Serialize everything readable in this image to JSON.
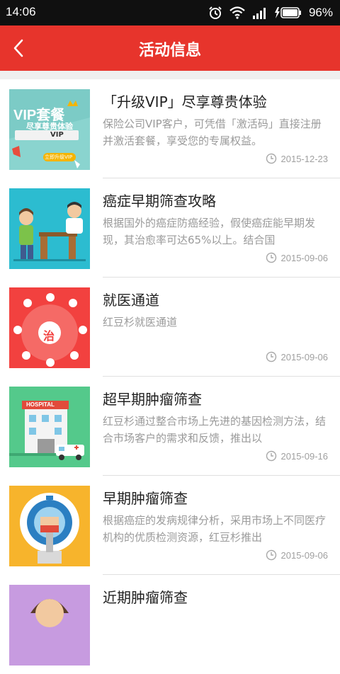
{
  "status": {
    "time": "14:06",
    "battery": "96%"
  },
  "header": {
    "title": "活动信息"
  },
  "items": [
    {
      "title": "「升级VIP」尽享尊贵体验",
      "desc": "保险公司VIP客户，可凭借「激活码」直接注册并激活套餐，享受您的专属权益。",
      "date": "2015-12-23",
      "thumb": {
        "line1": "VIP套餐",
        "line2": "尽享尊贵体验",
        "badge": "VIP",
        "button": "立即升级VIP"
      }
    },
    {
      "title": "癌症早期筛查攻略",
      "desc": "根据国外的癌症防癌经验，假使癌症能早期发现，其治愈率可达65%以上。结合国",
      "date": "2015-09-06"
    },
    {
      "title": "就医通道",
      "desc": "红豆杉就医通道",
      "date": "2015-09-06",
      "thumb": {
        "center": "治"
      }
    },
    {
      "title": "超早期肿瘤筛查",
      "desc": "红豆杉通过整合市场上先进的基因检测方法，结合市场客户的需求和反馈，推出以",
      "date": "2015-09-16",
      "thumb": {
        "sign": "HOSPITAL"
      }
    },
    {
      "title": "早期肿瘤筛查",
      "desc": "根据癌症的发病规律分析，采用市场上不同医疗机构的优质检测资源，红豆杉推出",
      "date": "2015-09-06"
    },
    {
      "title": "近期肿瘤筛查",
      "desc": "",
      "date": ""
    }
  ]
}
